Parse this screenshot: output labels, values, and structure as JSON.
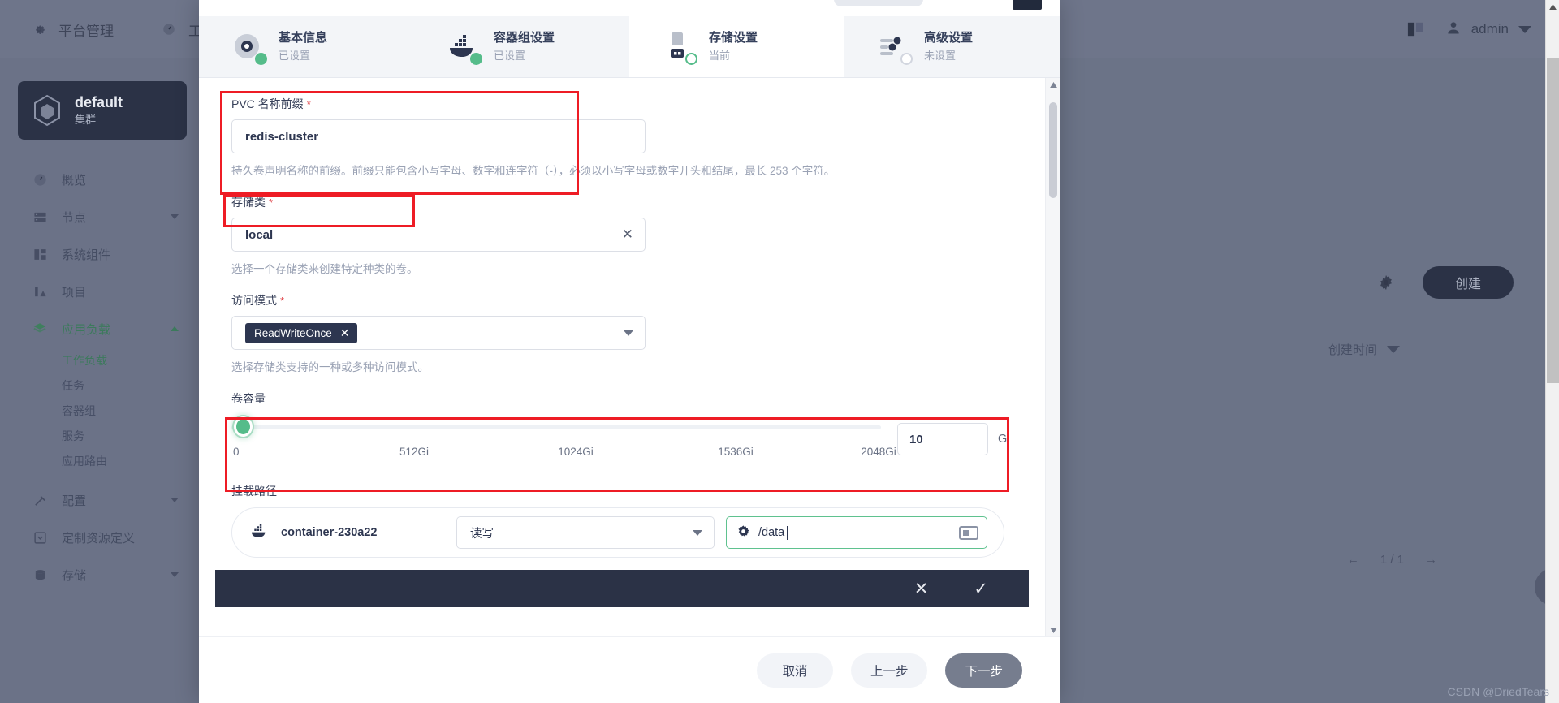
{
  "backdrop": {
    "topnav": [
      {
        "label": "平台管理",
        "icon": "gear-icon"
      },
      {
        "label": "工作台",
        "icon": "dashboard-icon"
      }
    ],
    "user": {
      "name": "admin",
      "icon": "user-icon"
    },
    "book_icon": "book-icon",
    "cluster": {
      "name": "default",
      "subtitle": "集群",
      "icon": "cube-icon"
    },
    "nav": [
      {
        "label": "概览",
        "icon": "dashboard-icon",
        "active": false,
        "chevron": ""
      },
      {
        "label": "节点",
        "icon": "server-icon",
        "active": false,
        "chevron": "down"
      },
      {
        "label": "系统组件",
        "icon": "components-icon",
        "active": false,
        "chevron": ""
      },
      {
        "label": "项目",
        "icon": "project-icon",
        "active": false,
        "chevron": ""
      },
      {
        "label": "应用负载",
        "icon": "layers-icon",
        "active": true,
        "chevron": "up"
      }
    ],
    "nav_sub": [
      {
        "label": "工作负载",
        "active": true
      },
      {
        "label": "任务",
        "active": false
      },
      {
        "label": "容器组",
        "active": false
      },
      {
        "label": "服务",
        "active": false
      },
      {
        "label": "应用路由",
        "active": false
      }
    ],
    "nav_tail": [
      {
        "label": "配置",
        "icon": "hammer-icon",
        "chevron": "down"
      },
      {
        "label": "定制资源定义",
        "icon": "crd-icon",
        "chevron": ""
      },
      {
        "label": "存储",
        "icon": "storage-icon",
        "chevron": "down"
      }
    ],
    "create_button": "创建",
    "gear_icon": "gear-icon",
    "sort_label": "创建时间",
    "pagination": "1 / 1"
  },
  "modal": {
    "steps": [
      {
        "title": "基本信息",
        "status": "已设置",
        "icon": "metadata-icon",
        "state": "done"
      },
      {
        "title": "容器组设置",
        "status": "已设置",
        "icon": "docker-icon",
        "state": "done"
      },
      {
        "title": "存储设置",
        "status": "当前",
        "icon": "volume-icon",
        "state": "current"
      },
      {
        "title": "高级设置",
        "status": "未设置",
        "icon": "sliders-icon",
        "state": "todo"
      }
    ],
    "form": {
      "pvc_prefix": {
        "label": "PVC 名称前缀",
        "required": "*",
        "value": "redis-cluster",
        "hint": "持久卷声明名称的前缀。前缀只能包含小写字母、数字和连字符（-），必须以小写字母或数字开头和结尾，最长 253 个字符。"
      },
      "storage_class": {
        "label": "存储类",
        "required": "*",
        "value": "local",
        "clear_icon": "✕",
        "hint": "选择一个存储类来创建特定种类的卷。"
      },
      "access_mode": {
        "label": "访问模式",
        "required": "*",
        "tag": "ReadWriteOnce",
        "tag_remove_icon": "✕",
        "hint": "选择存储类支持的一种或多种访问模式。"
      },
      "capacity": {
        "label": "卷容量",
        "value": "10",
        "unit": "Gi",
        "ticks": [
          "0",
          "512Gi",
          "1024Gi",
          "1536Gi",
          "2048Gi"
        ],
        "min": 0,
        "max": 2048,
        "current": 10
      },
      "mount_path": {
        "label": "挂载路径",
        "container_name": "container-230a22",
        "container_icon": "docker-icon",
        "mode": "读写",
        "path_icon": "settings-icon",
        "path_value": "/data",
        "keyboard_icon": "keyboard-icon"
      }
    },
    "actionbar": {
      "cancel_icon": "✕",
      "confirm_icon": "✓"
    },
    "footer": {
      "cancel": "取消",
      "previous": "上一步",
      "next": "下一步"
    }
  },
  "watermark": "CSDN @DriedTears"
}
